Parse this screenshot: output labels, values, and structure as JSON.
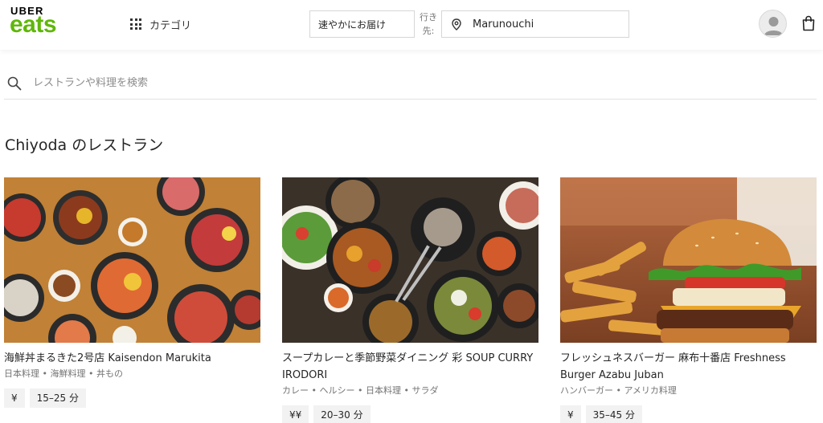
{
  "header": {
    "logo_top": "UBER",
    "logo_bottom": "eats",
    "category_label": "カテゴリ",
    "delivery_option": "速やかにお届け",
    "destination_label": "行き先:",
    "location": "Marunouchi"
  },
  "search": {
    "placeholder": "レストランや料理を検索"
  },
  "section": {
    "title": "Chiyoda のレストラン"
  },
  "restaurants": [
    {
      "name": "海鮮丼まるきた2号店 Kaisendon Marukita",
      "tags": "日本料理 • 海鮮料理 • 丼もの",
      "price": "¥",
      "eta": "15–25 分"
    },
    {
      "name": "スープカレーと季節野菜ダイニング 彩 SOUP CURRY IRODORI",
      "tags": "カレー • ヘルシー • 日本料理 • サラダ",
      "price": "¥¥",
      "eta": "20–30 分"
    },
    {
      "name": "フレッシュネスバーガー 麻布十番店 Freshness Burger Azabu Juban",
      "tags": "ハンバーガー • アメリカ料理",
      "price": "¥",
      "eta": "35–45 分"
    }
  ],
  "colors": {
    "brand_green": "#5fb709",
    "text": "#262626",
    "muted": "#757575",
    "border": "#d6d6d6",
    "badge_bg": "#f2f2f2"
  }
}
